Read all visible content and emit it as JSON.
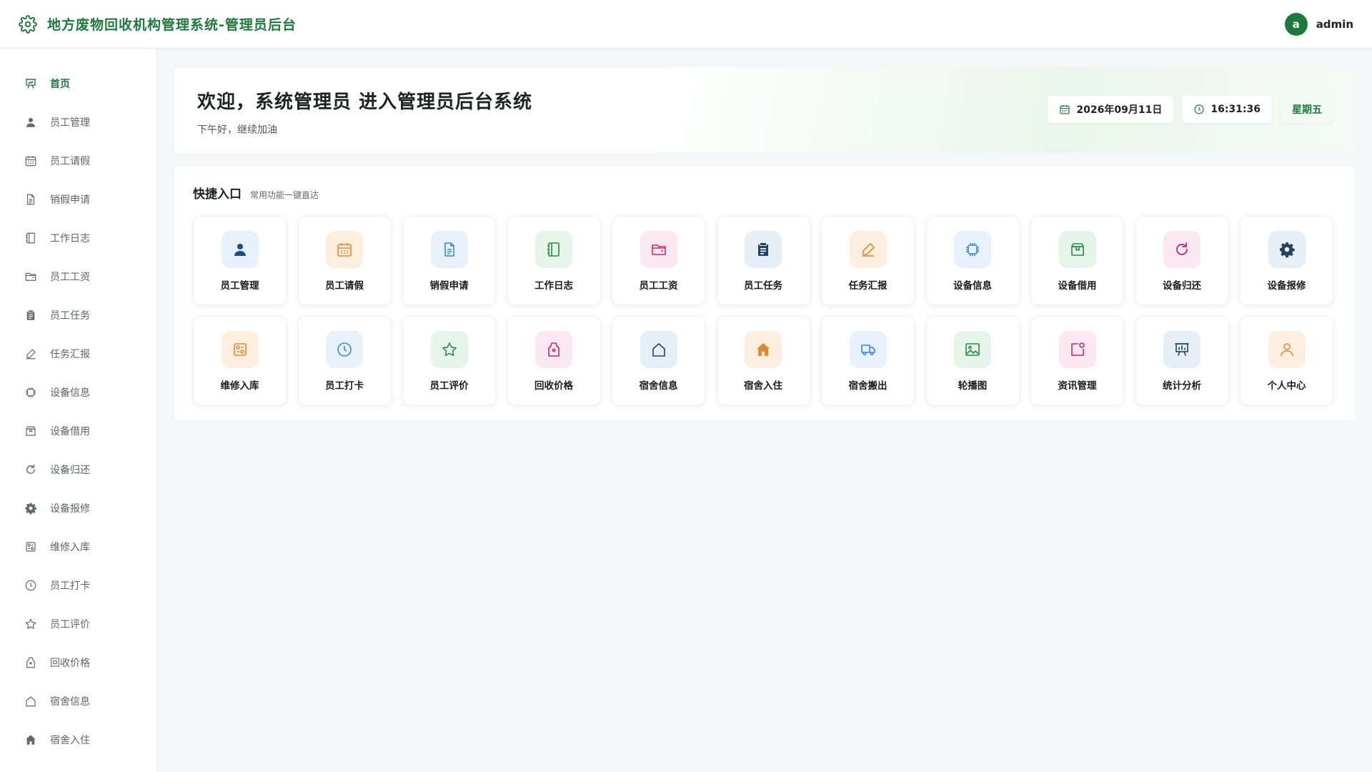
{
  "app": {
    "title": "地方废物回收机构管理系统-管理员后台",
    "user_initial": "a",
    "username": "admin"
  },
  "sidebar": {
    "items": [
      {
        "label": "首页",
        "icon": "home-board-icon",
        "active": true
      },
      {
        "label": "员工管理",
        "icon": "user-icon"
      },
      {
        "label": "员工请假",
        "icon": "calendar-icon"
      },
      {
        "label": "销假申请",
        "icon": "document-icon"
      },
      {
        "label": "工作日志",
        "icon": "notebook-icon"
      },
      {
        "label": "员工工资",
        "icon": "folder-icon"
      },
      {
        "label": "员工任务",
        "icon": "clipboard-icon"
      },
      {
        "label": "任务汇报",
        "icon": "pencil-icon"
      },
      {
        "label": "设备信息",
        "icon": "chip-icon"
      },
      {
        "label": "设备借用",
        "icon": "box-icon"
      },
      {
        "label": "设备归还",
        "icon": "refresh-icon"
      },
      {
        "label": "设备报修",
        "icon": "gear-icon"
      },
      {
        "label": "维修入库",
        "icon": "settings-panel-icon"
      },
      {
        "label": "员工打卡",
        "icon": "clock-icon"
      },
      {
        "label": "员工评价",
        "icon": "star-icon"
      },
      {
        "label": "回收价格",
        "icon": "price-tag-icon"
      },
      {
        "label": "宿舍信息",
        "icon": "house-outline-icon"
      },
      {
        "label": "宿舍入住",
        "icon": "house-filled-icon"
      }
    ]
  },
  "welcome": {
    "title": "欢迎，系统管理员 进入管理员后台系统",
    "subtitle": "下午好，继续加油",
    "date": "2026年09月11日",
    "time": "16:31:36",
    "weekday": "星期五"
  },
  "shortcuts": {
    "title": "快捷入口",
    "subtitle": "常用功能一键直达",
    "tiles": [
      {
        "label": "员工管理",
        "icon": "user-icon",
        "color": "blue"
      },
      {
        "label": "员工请假",
        "icon": "calendar-icon",
        "color": "orange"
      },
      {
        "label": "销假申请",
        "icon": "document-icon",
        "color": "lblue"
      },
      {
        "label": "工作日志",
        "icon": "notebook-icon",
        "color": "green"
      },
      {
        "label": "员工工资",
        "icon": "folder-icon",
        "color": "pink"
      },
      {
        "label": "员工任务",
        "icon": "clipboard-icon",
        "color": "navy"
      },
      {
        "label": "任务汇报",
        "icon": "pencil-icon",
        "color": "peach"
      },
      {
        "label": "设备信息",
        "icon": "chip-icon",
        "color": "lblue"
      },
      {
        "label": "设备借用",
        "icon": "box-icon",
        "color": "green"
      },
      {
        "label": "设备归还",
        "icon": "refresh-icon",
        "color": "pink"
      },
      {
        "label": "设备报修",
        "icon": "gear-icon",
        "color": "navy"
      },
      {
        "label": "维修入库",
        "icon": "settings-panel-icon",
        "color": "peach"
      },
      {
        "label": "员工打卡",
        "icon": "clock-icon",
        "color": "lblue"
      },
      {
        "label": "员工评价",
        "icon": "star-icon",
        "color": "green"
      },
      {
        "label": "回收价格",
        "icon": "price-tag-icon",
        "color": "pink"
      },
      {
        "label": "宿舍信息",
        "icon": "house-outline-icon",
        "color": "navy"
      },
      {
        "label": "宿舍入住",
        "icon": "house-filled-icon",
        "color": "peach"
      },
      {
        "label": "宿舍搬出",
        "icon": "truck-icon",
        "color": "lblue"
      },
      {
        "label": "轮播图",
        "icon": "image-icon",
        "color": "green"
      },
      {
        "label": "资讯管理",
        "icon": "news-icon",
        "color": "pink"
      },
      {
        "label": "统计分析",
        "icon": "chart-board-icon",
        "color": "navy"
      },
      {
        "label": "个人中心",
        "icon": "person-outline-icon",
        "color": "peach"
      }
    ]
  },
  "colors": {
    "brand": "#1e7a3c",
    "background": "#f4f6f8"
  }
}
